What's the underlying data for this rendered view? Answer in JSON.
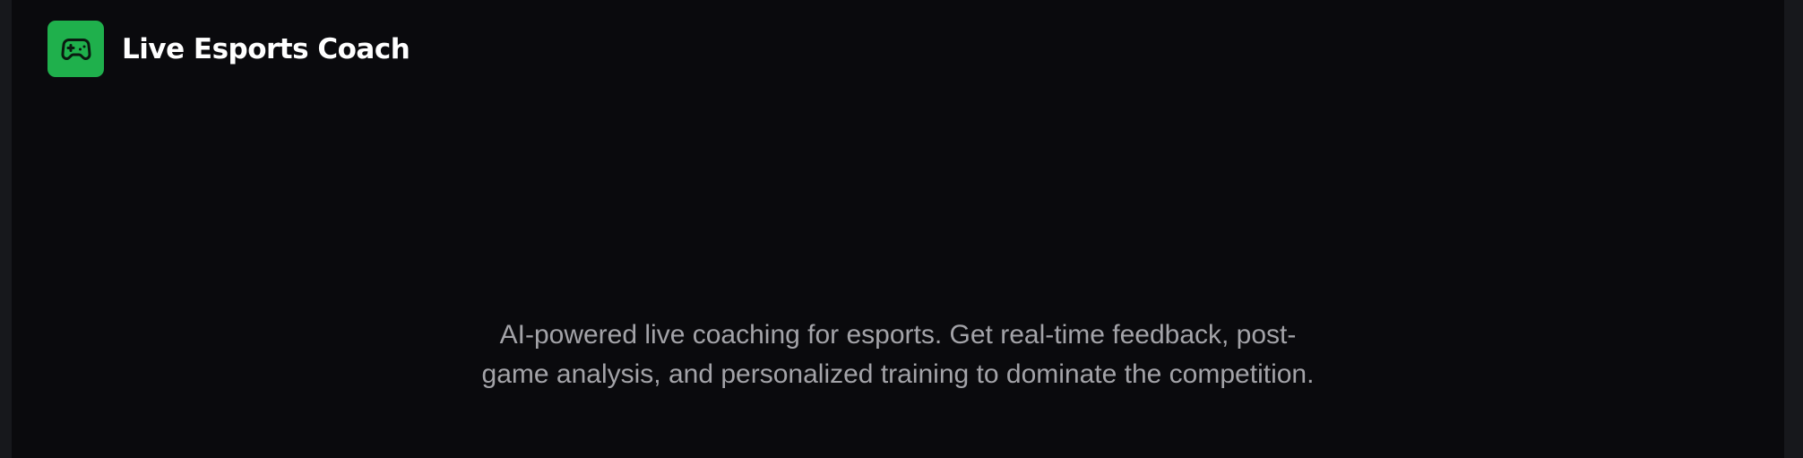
{
  "header": {
    "logo_icon": "gamepad-icon",
    "logo_color": "#1fb04c",
    "title": "Live Esports Coach"
  },
  "hero": {
    "tagline_line1": "AI-powered live coaching for esports. Get real-time feedback, post-",
    "tagline_line2": "game analysis, and personalized training to dominate the competition."
  }
}
